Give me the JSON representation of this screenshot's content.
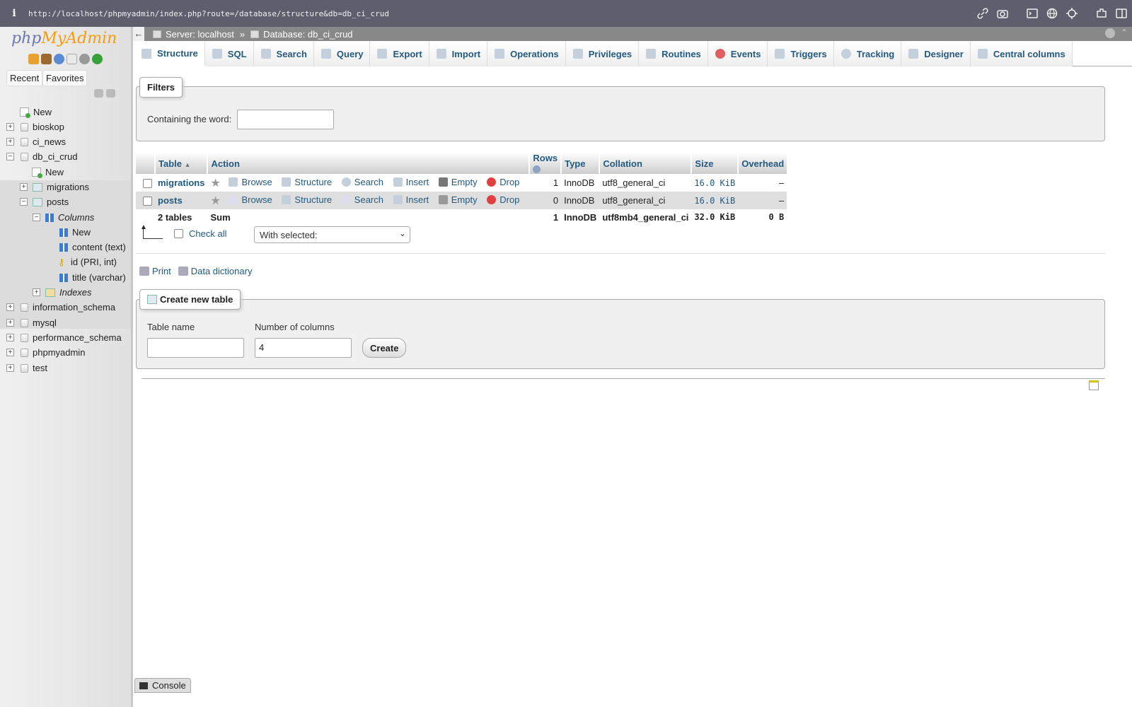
{
  "browser": {
    "info_icon": "i",
    "url": "http://localhost/phpmyadmin/index.php?route=/database/structure&db=db_ci_crud",
    "tools": [
      "link-icon",
      "camera-icon",
      "terminal-icon",
      "globe-icon",
      "crosshair-icon",
      "extension-icon",
      "sidebar-icon"
    ]
  },
  "nav": {
    "logo_php": "php",
    "logo_myadmin": "MyAdmin",
    "recent": "Recent",
    "favorites": "Favorites",
    "tree": {
      "new": "New",
      "dbs": [
        "bioskop",
        "ci_news",
        "db_ci_crud",
        "information_schema",
        "mysql",
        "performance_schema",
        "phpmyadmin",
        "test"
      ],
      "db_new": "New",
      "migrations": "migrations",
      "posts": "posts",
      "columns": "Columns",
      "col_new": "New",
      "col_content": "content (text)",
      "col_id": "id (PRI, int)",
      "col_title": "title (varchar)",
      "indexes": "Indexes"
    }
  },
  "topbar": {
    "back": "←",
    "server": "Server: localhost",
    "sep": "»",
    "database": "Database: db_ci_crud"
  },
  "tabs": [
    "Structure",
    "SQL",
    "Search",
    "Query",
    "Export",
    "Import",
    "Operations",
    "Privileges",
    "Routines",
    "Events",
    "Triggers",
    "Tracking",
    "Designer",
    "Central columns"
  ],
  "filters": {
    "legend": "Filters",
    "label": "Containing the word:",
    "value": ""
  },
  "table": {
    "headers": [
      "Table",
      "Action",
      "Rows",
      "Type",
      "Collation",
      "Size",
      "Overhead"
    ],
    "actions": [
      "Browse",
      "Structure",
      "Search",
      "Insert",
      "Empty",
      "Drop"
    ],
    "rows": [
      {
        "name": "migrations",
        "rows": "1",
        "type": "InnoDB",
        "collation": "utf8_general_ci",
        "size": "16.0 KiB",
        "overhead": "–"
      },
      {
        "name": "posts",
        "rows": "0",
        "type": "InnoDB",
        "collation": "utf8_general_ci",
        "size": "16.0 KiB",
        "overhead": "–"
      }
    ],
    "sum": {
      "name": "2 tables",
      "label": "Sum",
      "rows": "1",
      "type": "InnoDB",
      "collation": "utf8mb4_general_ci",
      "size": "32.0 KiB",
      "overhead": "0 B"
    }
  },
  "bulk": {
    "check_all": "Check all",
    "with_selected": "With selected:"
  },
  "links": {
    "print": "Print",
    "data_dictionary": "Data dictionary"
  },
  "create": {
    "legend": "Create new table",
    "table_name_label": "Table name",
    "table_name_value": "",
    "columns_label": "Number of columns",
    "columns_value": "4",
    "button": "Create"
  },
  "console": "Console",
  "colors": {
    "link": "#235a81",
    "logo_php": "#6c78af",
    "logo_myadmin": "#f89c0e"
  }
}
